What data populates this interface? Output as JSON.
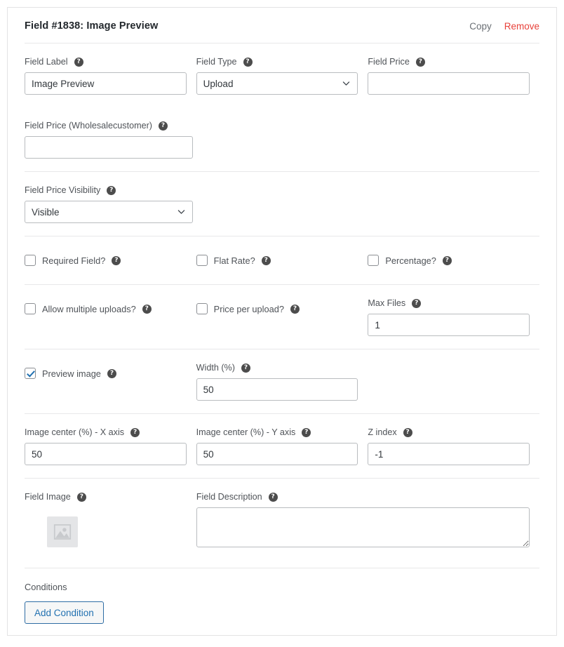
{
  "card": {
    "title": "Field #1838: Image Preview",
    "copy_label": "Copy",
    "remove_label": "Remove",
    "help_glyph": "?"
  },
  "colors": {
    "accent_blue": "#2271b1",
    "danger_red": "#e8413a",
    "label_gray": "#4f5358",
    "border_gray": "#b9bcbf",
    "divider_gray": "#e8e8e9"
  },
  "fields": {
    "field_label": {
      "label": "Field Label",
      "value": "Image Preview"
    },
    "field_type": {
      "label": "Field Type",
      "value": "Upload"
    },
    "field_price": {
      "label": "Field Price",
      "value": ""
    },
    "field_price_wholesale": {
      "label": "Field Price (Wholesalecustomer)",
      "value": ""
    },
    "field_price_visibility": {
      "label": "Field Price Visibility",
      "value": "Visible"
    },
    "required_field": {
      "label": "Required Field?",
      "checked": false
    },
    "flat_rate": {
      "label": "Flat Rate?",
      "checked": false
    },
    "percentage": {
      "label": "Percentage?",
      "checked": false
    },
    "allow_multiple_uploads": {
      "label": "Allow multiple uploads?",
      "checked": false
    },
    "price_per_upload": {
      "label": "Price per upload?",
      "checked": false
    },
    "max_files": {
      "label": "Max Files",
      "value": "1"
    },
    "preview_image": {
      "label": "Preview image",
      "checked": true
    },
    "width_percent": {
      "label": "Width (%)",
      "value": "50"
    },
    "image_center_x": {
      "label": "Image center (%) - X axis",
      "value": "50"
    },
    "image_center_y": {
      "label": "Image center (%) - Y axis",
      "value": "50"
    },
    "z_index": {
      "label": "Z index",
      "value": "-1"
    },
    "field_image": {
      "label": "Field Image"
    },
    "field_description": {
      "label": "Field Description",
      "value": ""
    }
  },
  "conditions": {
    "label": "Conditions",
    "add_button_label": "Add Condition"
  }
}
